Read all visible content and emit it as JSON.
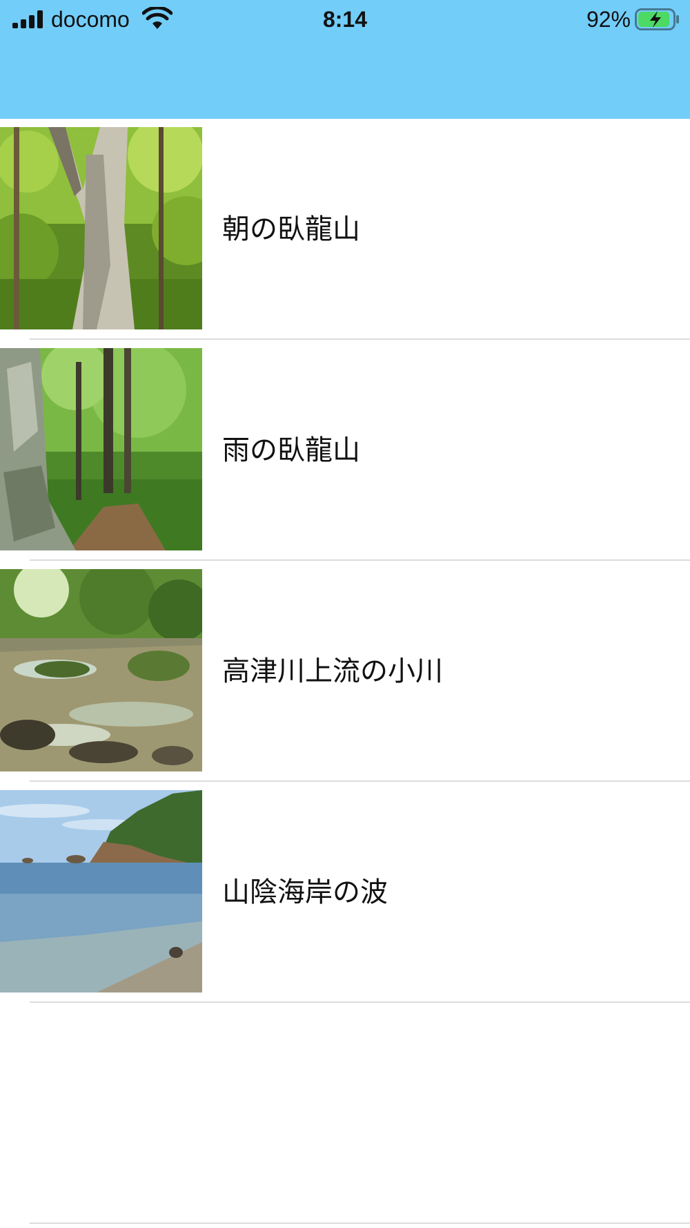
{
  "status_bar": {
    "carrier": "docomo",
    "time": "8:14",
    "battery_percent": "92%",
    "battery_level": 0.92,
    "charging": true,
    "signal_bars": 4
  },
  "nav_bar": {
    "background_color": "#72cdf9"
  },
  "list": {
    "items": [
      {
        "label": "朝の臥龍山",
        "thumbnail": "forest-beech-tree-photo"
      },
      {
        "label": "雨の臥龍山",
        "thumbnail": "forest-path-rain-photo"
      },
      {
        "label": "高津川上流の小川",
        "thumbnail": "mountain-stream-photo"
      },
      {
        "label": "山陰海岸の波",
        "thumbnail": "coastline-sea-photo"
      }
    ]
  },
  "colors": {
    "accent": "#72cdf9",
    "battery_green": "#4cd964",
    "separator": "#dcdcdc"
  }
}
